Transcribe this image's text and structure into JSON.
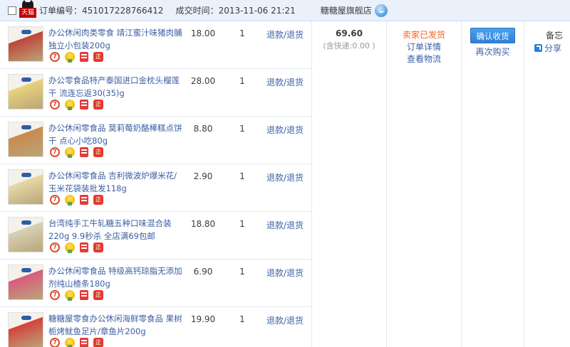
{
  "header": {
    "tmall_label": "天猫",
    "order_no_label": "订单编号：",
    "order_no": "451017228766412",
    "time_label": "成交时间：",
    "time": "2013-11-06 21:21",
    "shop_name": "糖糖屋旗舰店"
  },
  "items": [
    {
      "title": "办公休闲肉类零食 靖江蜜汁味猪肉脯独立小包装200g",
      "price": "18.00",
      "qty": "1",
      "refund": "退款/退货",
      "thumb_color": "#c0453a"
    },
    {
      "title": "办公零食品特产泰国进口金枕头榴莲干 流连忘返30(35)g",
      "price": "28.00",
      "qty": "1",
      "refund": "退款/退货",
      "thumb_color": "#e9d27a"
    },
    {
      "title": "办公休闲零食品 莫莉莓奶酪棒糕点饼干 点心小吃80g",
      "price": "8.80",
      "qty": "1",
      "refund": "退款/退货",
      "thumb_color": "#c98a4d"
    },
    {
      "title": "办公休闲零食品 吉利微波炉爆米花/玉米花袋装批发118g",
      "price": "2.90",
      "qty": "1",
      "refund": "退款/退货",
      "thumb_color": "#e7d9a7"
    },
    {
      "title": "台湾纯手工牛轧糖五种口味混合装 220g 9.9秒杀 全店满69包邮",
      "price": "18.80",
      "qty": "1",
      "refund": "退款/退货",
      "thumb_color": "#d8d2b5"
    },
    {
      "title": "办公休闲零食品 特级高钙琼脂无添加剂纯山楂条180g",
      "price": "6.90",
      "qty": "1",
      "refund": "退款/退货",
      "thumb_color": "#d95b7a"
    },
    {
      "title": "糖糖屋零食办公休闲海鲜零食品 果树栀烤鱿鱼足片/章鱼片200g",
      "price": "19.90",
      "qty": "1",
      "refund": "退款/退货",
      "thumb_color": "#d6423a"
    }
  ],
  "summary": {
    "total": "69.60",
    "shipping": "(含快递:0.00 )"
  },
  "status": {
    "text": "卖家已发货",
    "detail_link": "订单详情",
    "logistics_link": "查看物流"
  },
  "actions": {
    "confirm": "确认收货",
    "rebuy": "再次购买"
  },
  "misc": {
    "note": "备忘",
    "share": "分享"
  },
  "service_icons": [
    "seven-day-return-icon",
    "gold-badge-icon",
    "invoice-icon",
    "genuine-icon"
  ],
  "service_icon_texts": {
    "seven": "7",
    "real": "正"
  },
  "colors": {
    "header_bg": "#eaf1fb",
    "link_blue": "#3c5fa3",
    "status_orange": "#f26522",
    "button_blue": "#2d7fd6",
    "tmall_red": "#c40000"
  }
}
